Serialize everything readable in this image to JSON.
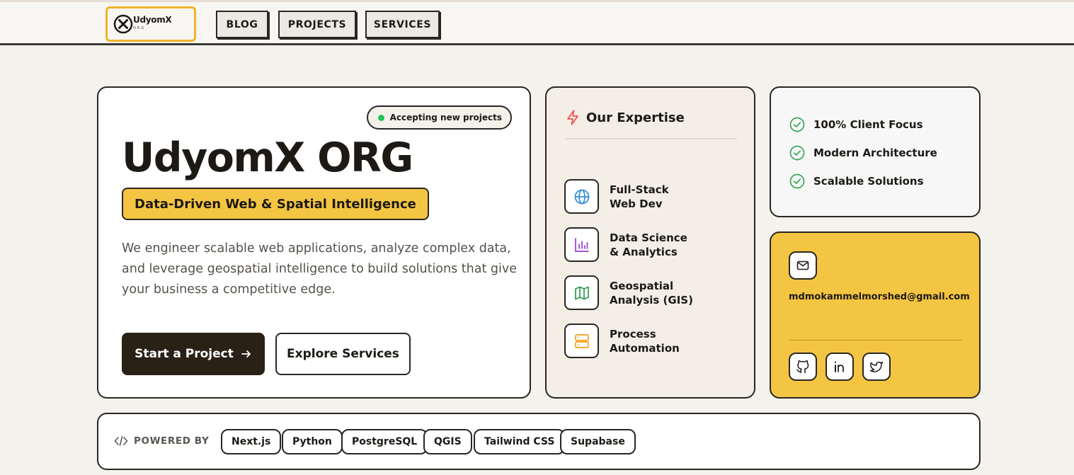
{
  "logo": {
    "name": "UdyomX",
    "sub": "ORG"
  },
  "nav": {
    "items": [
      "BLOG",
      "PROJECTS",
      "SERVICES"
    ]
  },
  "hero": {
    "badge": "Accepting new projects",
    "title": "UdyomX ORG",
    "tagline": "Data-Driven Web & Spatial Intelligence",
    "description": "We engineer scalable web applications, analyze complex data, and leverage geospatial intelligence to build solutions that give your business a competitive edge.",
    "primary_cta": "Start a Project",
    "secondary_cta": "Explore Services"
  },
  "expertise": {
    "title": "Our Expertise",
    "items": [
      {
        "line1": "Full-Stack",
        "line2": "Web Dev",
        "icon": "globe-icon",
        "color": "#2f8fd8"
      },
      {
        "line1": "Data Science",
        "line2": "& Analytics",
        "icon": "bar-chart-icon",
        "color": "#9b3fd0"
      },
      {
        "line1": "Geospatial",
        "line2": "Analysis (GIS)",
        "icon": "map-icon",
        "color": "#2f9a4d"
      },
      {
        "line1": "Process",
        "line2": "Automation",
        "icon": "server-icon",
        "color": "#f2a019"
      }
    ]
  },
  "benefits": [
    "100% Client Focus",
    "Modern Architecture",
    "Scalable Solutions"
  ],
  "contact": {
    "email": "mdmokammelmorshed@gmail.com"
  },
  "powered_by": {
    "label": "POWERED BY",
    "tech": [
      "Next.js",
      "Python",
      "PostgreSQL",
      "QGIS",
      "Tailwind CSS",
      "Supabase"
    ]
  },
  "colors": {
    "accent_yellow": "#f4c542",
    "logo_border": "#f0b429",
    "dark": "#2a2116",
    "status_green": "#22c55e",
    "bolt": "#ef5350"
  }
}
